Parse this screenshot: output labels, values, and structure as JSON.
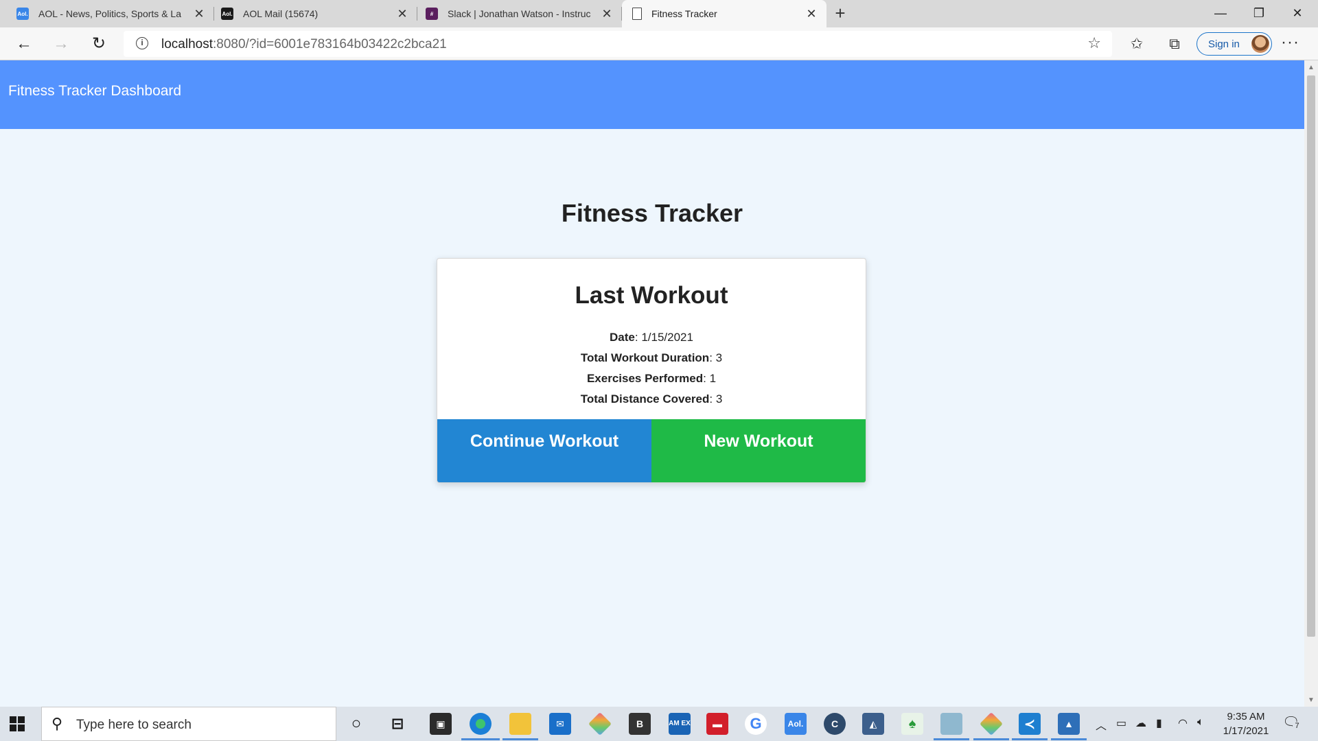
{
  "browser": {
    "tabs": [
      {
        "title": "AOL - News, Politics, Sports & La",
        "favicon": "aol-icon",
        "active": false
      },
      {
        "title": "AOL Mail (15674)",
        "favicon": "aol-mail-icon",
        "active": false
      },
      {
        "title": "Slack | Jonathan Watson - Instruc",
        "favicon": "slack-icon",
        "active": false
      },
      {
        "title": "Fitness Tracker",
        "favicon": "page-icon",
        "active": true
      }
    ],
    "favicon_text": {
      "aol": "Aol.",
      "aol_mail": "Aol.",
      "slack": "#"
    },
    "url_host": "localhost",
    "url_rest": ":8080/?id=6001e783164b03422c2bca21",
    "sign_in_label": "Sign in"
  },
  "page": {
    "nav_brand": "Fitness Tracker Dashboard",
    "title": "Fitness Tracker",
    "card": {
      "heading": "Last Workout",
      "stats": [
        {
          "label": "Date",
          "value": ": 1/15/2021"
        },
        {
          "label": "Total Workout Duration",
          "value": ": 3"
        },
        {
          "label": "Exercises Performed",
          "value": ": 1"
        },
        {
          "label": "Total Distance Covered",
          "value": ": 3"
        }
      ],
      "continue_label": "Continue Workout",
      "new_label": "New Workout"
    }
  },
  "colors": {
    "nav": "#5493fe",
    "continue": "#2286d3",
    "new": "#1fba47",
    "background": "#eef6fd"
  },
  "taskbar": {
    "search_placeholder": "Type here to search",
    "time": "9:35 AM",
    "date": "1/17/2021",
    "notification_count": "7",
    "app_labels": {
      "b": "B",
      "amex": "AM EX",
      "aol": "Aol.",
      "cc": "C"
    }
  }
}
